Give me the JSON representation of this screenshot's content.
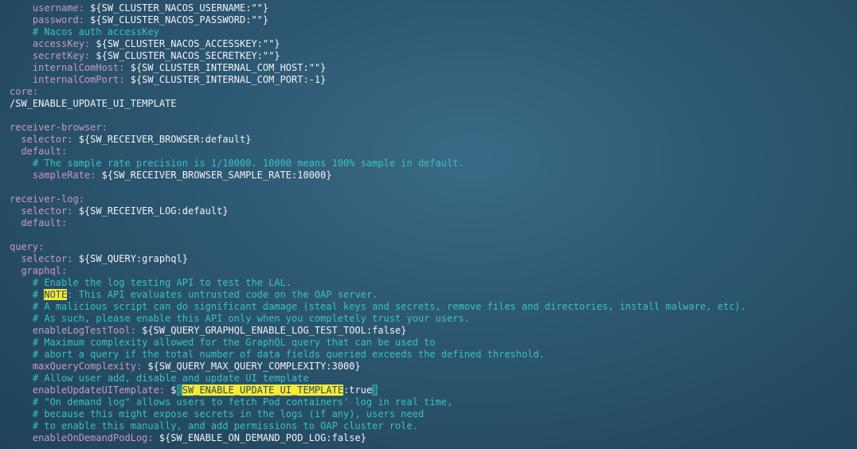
{
  "colors": {
    "key": "#c99ac0",
    "value": "#f2f4f5",
    "comment": "#39c2c0",
    "highlight": "#f6ea38",
    "background": "#2c5670"
  },
  "lines": [
    {
      "indent": "    ",
      "segments": [
        {
          "t": "username:",
          "c": "key"
        },
        {
          "t": " ${SW_CLUSTER_NACOS_USERNAME:\"\"}",
          "c": "val"
        }
      ]
    },
    {
      "indent": "    ",
      "segments": [
        {
          "t": "password:",
          "c": "key"
        },
        {
          "t": " ${SW_CLUSTER_NACOS_PASSWORD:\"\"}",
          "c": "val"
        }
      ]
    },
    {
      "indent": "    ",
      "segments": [
        {
          "t": "# Nacos auth accessKey",
          "c": "cmt"
        }
      ]
    },
    {
      "indent": "    ",
      "segments": [
        {
          "t": "accessKey:",
          "c": "key"
        },
        {
          "t": " ${SW_CLUSTER_NACOS_ACCESSKEY:\"\"}",
          "c": "val"
        }
      ]
    },
    {
      "indent": "    ",
      "segments": [
        {
          "t": "secretKey:",
          "c": "key"
        },
        {
          "t": " ${SW_CLUSTER_NACOS_SECRETKEY:\"\"}",
          "c": "val"
        }
      ]
    },
    {
      "indent": "    ",
      "segments": [
        {
          "t": "internalComHost:",
          "c": "key"
        },
        {
          "t": " ${SW_CLUSTER_INTERNAL_COM_HOST:\"\"}",
          "c": "val"
        }
      ]
    },
    {
      "indent": "    ",
      "segments": [
        {
          "t": "internalComPort:",
          "c": "key"
        },
        {
          "t": " ${SW_CLUSTER_INTERNAL_COM_PORT:-1}",
          "c": "val"
        }
      ]
    },
    {
      "indent": "",
      "segments": [
        {
          "t": "core:",
          "c": "key"
        }
      ]
    },
    {
      "indent": "",
      "segments": [
        {
          "t": "/SW_ENABLE_UPDATE_UI_TEMPLATE",
          "c": "val"
        }
      ]
    },
    {
      "indent": "",
      "segments": []
    },
    {
      "indent": "",
      "segments": [
        {
          "t": "receiver-browser:",
          "c": "key"
        }
      ]
    },
    {
      "indent": "  ",
      "segments": [
        {
          "t": "selector:",
          "c": "key"
        },
        {
          "t": " ${SW_RECEIVER_BROWSER:default}",
          "c": "val"
        }
      ]
    },
    {
      "indent": "  ",
      "segments": [
        {
          "t": "default:",
          "c": "key"
        }
      ]
    },
    {
      "indent": "    ",
      "segments": [
        {
          "t": "# The sample rate precision is 1/10000. 10000 means 100% sample in default.",
          "c": "cmt"
        }
      ]
    },
    {
      "indent": "    ",
      "segments": [
        {
          "t": "sampleRate:",
          "c": "key"
        },
        {
          "t": " ${SW_RECEIVER_BROWSER_SAMPLE_RATE:10000}",
          "c": "val"
        }
      ]
    },
    {
      "indent": "",
      "segments": []
    },
    {
      "indent": "",
      "segments": [
        {
          "t": "receiver-log:",
          "c": "key"
        }
      ]
    },
    {
      "indent": "  ",
      "segments": [
        {
          "t": "selector:",
          "c": "key"
        },
        {
          "t": " ${SW_RECEIVER_LOG:default}",
          "c": "val"
        }
      ]
    },
    {
      "indent": "  ",
      "segments": [
        {
          "t": "default:",
          "c": "key"
        }
      ]
    },
    {
      "indent": "",
      "segments": []
    },
    {
      "indent": "",
      "segments": [
        {
          "t": "query:",
          "c": "key"
        }
      ]
    },
    {
      "indent": "  ",
      "segments": [
        {
          "t": "selector:",
          "c": "key"
        },
        {
          "t": " ${SW_QUERY:graphql}",
          "c": "val"
        }
      ]
    },
    {
      "indent": "  ",
      "segments": [
        {
          "t": "graphql:",
          "c": "key"
        }
      ]
    },
    {
      "indent": "    ",
      "segments": [
        {
          "t": "# Enable the log testing API to test the LAL.",
          "c": "cmt"
        }
      ]
    },
    {
      "indent": "    ",
      "segments": [
        {
          "t": "# ",
          "c": "cmt"
        },
        {
          "t": "NOTE",
          "c": "hl"
        },
        {
          "t": ": This API evaluates untrusted code on the OAP server.",
          "c": "cmt"
        }
      ]
    },
    {
      "indent": "    ",
      "segments": [
        {
          "t": "# A malicious script can do significant damage (steal keys and secrets, remove files and directories, install malware, etc).",
          "c": "cmt"
        }
      ]
    },
    {
      "indent": "    ",
      "segments": [
        {
          "t": "# As such, please enable this API only when you completely trust your users.",
          "c": "cmt"
        }
      ]
    },
    {
      "indent": "    ",
      "segments": [
        {
          "t": "enableLogTestTool:",
          "c": "key"
        },
        {
          "t": " ${SW_QUERY_GRAPHQL_ENABLE_LOG_TEST_TOOL:false}",
          "c": "val"
        }
      ]
    },
    {
      "indent": "    ",
      "segments": [
        {
          "t": "# Maximum complexity allowed for the GraphQL query that can be used to",
          "c": "cmt"
        }
      ]
    },
    {
      "indent": "    ",
      "segments": [
        {
          "t": "# abort a query if the total number of data fields queried exceeds the defined threshold.",
          "c": "cmt"
        }
      ]
    },
    {
      "indent": "    ",
      "segments": [
        {
          "t": "maxQueryComplexity:",
          "c": "key"
        },
        {
          "t": " ${SW_QUERY_MAX_QUERY_COMPLEXITY:3000}",
          "c": "val"
        }
      ]
    },
    {
      "indent": "    ",
      "segments": [
        {
          "t": "# Allow user add, disable and update UI template",
          "c": "cmt"
        }
      ]
    },
    {
      "indent": "    ",
      "segments": [
        {
          "t": "enableUpdateUITemplate:",
          "c": "key"
        },
        {
          "t": " $",
          "c": "val"
        },
        {
          "t": "{",
          "c": "hlc"
        },
        {
          "t": "SW_ENABLE_UPDATE_UI_TEMPLATE",
          "c": "hl"
        },
        {
          "t": ":true",
          "c": "val"
        },
        {
          "t": "}",
          "c": "hlc"
        }
      ]
    },
    {
      "indent": "    ",
      "segments": [
        {
          "t": "# \"On demand log\" allows users to fetch Pod containers' log in real time,",
          "c": "cmt"
        }
      ]
    },
    {
      "indent": "    ",
      "segments": [
        {
          "t": "# because this might expose secrets in the logs (if any), users need",
          "c": "cmt"
        }
      ]
    },
    {
      "indent": "    ",
      "segments": [
        {
          "t": "# to enable this manually, and add permissions to OAP cluster role.",
          "c": "cmt"
        }
      ]
    },
    {
      "indent": "    ",
      "segments": [
        {
          "t": "enableOnDemandPodLog:",
          "c": "key"
        },
        {
          "t": " ${SW_ENABLE_ON_DEMAND_POD_LOG:false}",
          "c": "val"
        }
      ]
    }
  ]
}
